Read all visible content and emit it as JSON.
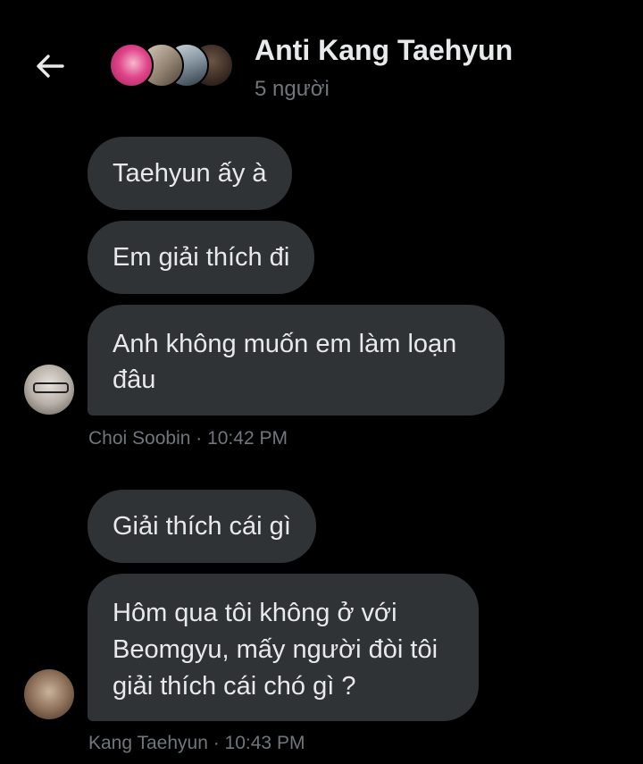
{
  "header": {
    "title": "Anti Kang Taehyun",
    "subtitle": "5 người"
  },
  "icons": {
    "back": "arrow-left-icon"
  },
  "colors": {
    "background": "#000000",
    "bubble": "#2f3336",
    "text": "#e7e9ea",
    "muted": "#71767b"
  },
  "messages": {
    "group1": {
      "m1": "Taehyun ấy à",
      "m2": "Em giải thích đi",
      "m3_line1": "Anh không muốn em làm loạn",
      "m3_line2": "đâu",
      "meta": "Choi Soobin · 10:42 PM"
    },
    "group2": {
      "m1": "Giải thích cái gì",
      "m2_line1": "Hôm qua tôi không ở với",
      "m2_line2": "Beomgyu, mấy người đòi tôi",
      "m2_line3": "giải thích cái chó gì ?",
      "meta": "Kang Taehyun · 10:43 PM"
    }
  }
}
